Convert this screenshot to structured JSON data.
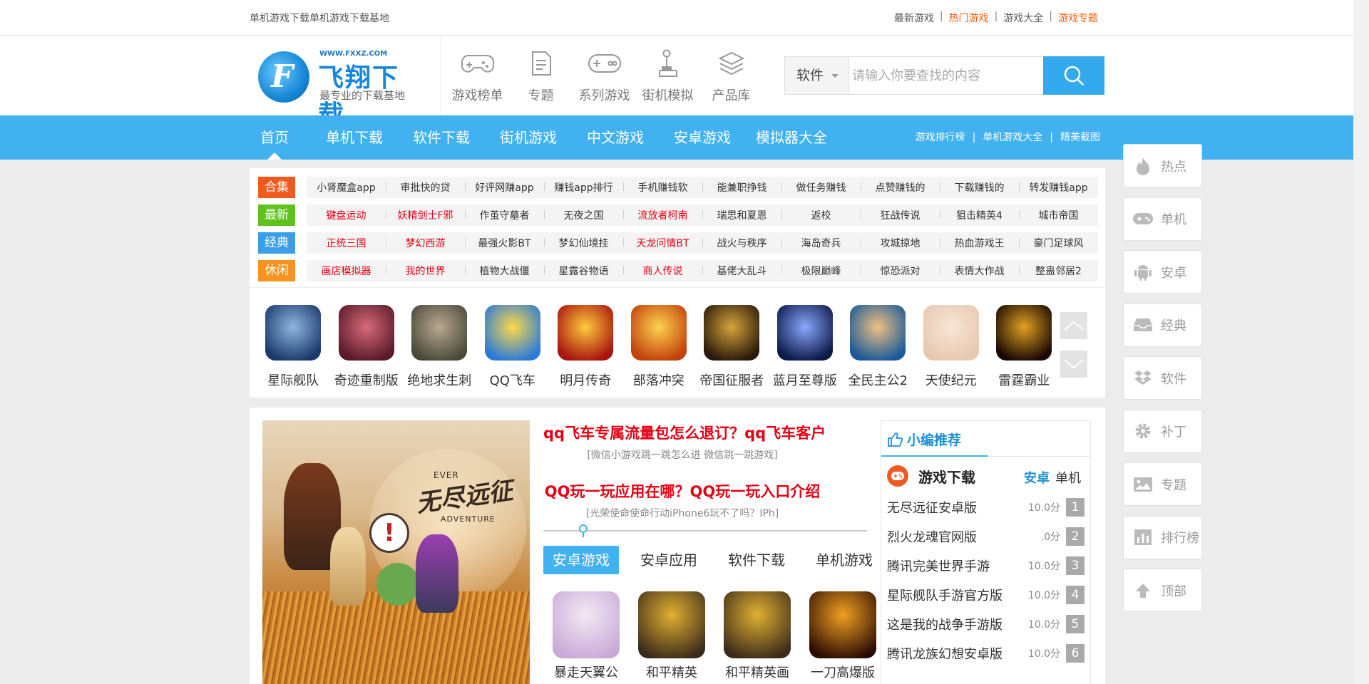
{
  "topbar": {
    "slogan": "单机游戏下载单机游戏下载基地",
    "links": [
      {
        "label": "最新游戏",
        "hot": false
      },
      {
        "label": "热门游戏",
        "hot": true
      },
      {
        "label": "游戏大全",
        "hot": false
      },
      {
        "label": "游戏专题",
        "hot": true
      }
    ]
  },
  "logo": {
    "url": "WWW.FXXZ.COM",
    "name": "飞翔下载",
    "tagline": "最专业的下载基地"
  },
  "header_nav": [
    {
      "label": "游戏榜单",
      "icon": "gamepad-icon"
    },
    {
      "label": "专题",
      "icon": "document-icon"
    },
    {
      "label": "系列游戏",
      "icon": "controller-icon"
    },
    {
      "label": "街机模拟",
      "icon": "joystick-icon"
    },
    {
      "label": "产品库",
      "icon": "layers-icon"
    }
  ],
  "search": {
    "category": "软件",
    "placeholder": "请输入你要查找的内容"
  },
  "main_nav": {
    "links": [
      "首页",
      "单机下载",
      "软件下载",
      "街机游戏",
      "中文游戏",
      "安卓游戏",
      "模拟器大全"
    ],
    "active_index": 0,
    "right_links": [
      "游戏排行榜",
      "单机游戏大全",
      "精美截图"
    ]
  },
  "tag_rows": [
    {
      "badge": "合集",
      "color": "#f05a1e",
      "items": [
        {
          "t": "小肾魔盒app",
          "red": false
        },
        {
          "t": "审批快的贷",
          "red": false
        },
        {
          "t": "好评网赚app",
          "red": false
        },
        {
          "t": "赚钱app排行",
          "red": false
        },
        {
          "t": "手机赚钱软",
          "red": false
        },
        {
          "t": "能兼职挣钱",
          "red": false
        },
        {
          "t": "做任务赚钱",
          "red": false
        },
        {
          "t": "点赞赚钱的",
          "red": false
        },
        {
          "t": "下载赚钱的",
          "red": false
        },
        {
          "t": "转发赚钱app",
          "red": false
        }
      ]
    },
    {
      "badge": "最新",
      "color": "#5ec21b",
      "items": [
        {
          "t": "键盘运动",
          "red": true
        },
        {
          "t": "妖精剑士F邪",
          "red": true
        },
        {
          "t": "作茧守墓者",
          "red": false
        },
        {
          "t": "无夜之国",
          "red": false
        },
        {
          "t": "流放者柯南",
          "red": true
        },
        {
          "t": "瑞思和夏恩",
          "red": false
        },
        {
          "t": "返校",
          "red": false
        },
        {
          "t": "狂战传说",
          "red": false
        },
        {
          "t": "狙击精英4",
          "red": false
        },
        {
          "t": "城市帝国",
          "red": false
        }
      ]
    },
    {
      "badge": "经典",
      "color": "#3a9ee8",
      "items": [
        {
          "t": "正统三国",
          "red": true
        },
        {
          "t": "梦幻西游",
          "red": true
        },
        {
          "t": "最强火影BT",
          "red": false
        },
        {
          "t": "梦幻仙境挂",
          "red": false
        },
        {
          "t": "天龙问情BT",
          "red": true
        },
        {
          "t": "战火与秩序",
          "red": false
        },
        {
          "t": "海岛奇兵",
          "red": false
        },
        {
          "t": "攻城掠地",
          "red": false
        },
        {
          "t": "热血游戏王",
          "red": false
        },
        {
          "t": "豪门足球风",
          "red": false
        }
      ]
    },
    {
      "badge": "休闲",
      "color": "#f7931e",
      "items": [
        {
          "t": "画店模拟器",
          "red": true
        },
        {
          "t": "我的世界",
          "red": true
        },
        {
          "t": "植物大战僵",
          "red": false
        },
        {
          "t": "星露谷物语",
          "red": false
        },
        {
          "t": "商人传说",
          "red": true
        },
        {
          "t": "基佬大乱斗",
          "red": false
        },
        {
          "t": "极限巅峰",
          "red": false
        },
        {
          "t": "惊恐派对",
          "red": false
        },
        {
          "t": "表情大作战",
          "red": false
        },
        {
          "t": "整蛊邻居2",
          "red": false
        }
      ]
    }
  ],
  "game_icons": [
    {
      "name": "星际舰队",
      "c1": "#1b3a6b",
      "c2": "#8fb6e0"
    },
    {
      "name": "奇迹重制版",
      "c1": "#5a1a2a",
      "c2": "#d86a7a"
    },
    {
      "name": "绝地求生刺",
      "c1": "#4a4a3a",
      "c2": "#b8a890"
    },
    {
      "name": "QQ飞车",
      "c1": "#2a7ad8",
      "c2": "#ffd84a"
    },
    {
      "name": "明月传奇",
      "c1": "#a8140e",
      "c2": "#ffcb3a"
    },
    {
      "name": "部落冲突",
      "c1": "#c2410c",
      "c2": "#fcd34d"
    },
    {
      "name": "帝国征服者",
      "c1": "#2a1a0a",
      "c2": "#d6a43a"
    },
    {
      "name": "蓝月至尊版",
      "c1": "#0d1a4a",
      "c2": "#8aa8ff"
    },
    {
      "name": "全民主公2",
      "c1": "#1a5a9a",
      "c2": "#f0c080"
    },
    {
      "name": "天使纪元",
      "c1": "#e8c8b0",
      "c2": "#f6e6d6"
    },
    {
      "name": "雷霆霸业",
      "c1": "#1a0a04",
      "c2": "#e0a020"
    }
  ],
  "headlines": [
    {
      "title": "qq飞车专属流量包怎么退订？qq飞车客户",
      "sub": "[微信小游戏跳一跳怎么进 微信跳一跳游戏]"
    },
    {
      "title": "QQ玩一玩应用在哪？QQ玩一玩入口介绍",
      "sub": "[光荣使命使命行动iPhone6玩不了吗？IPh]"
    }
  ],
  "banner": {
    "logo_text": "无尽远征",
    "logo_sub": "EVER",
    "logo_sub2": "ADVENTURE",
    "bubble": "!"
  },
  "content_tabs": [
    "安卓游戏",
    "安卓应用",
    "软件下载",
    "单机游戏"
  ],
  "content_active_tab": 0,
  "apps": [
    {
      "name": "暴走天翼公",
      "c1": "#c8a8d8",
      "c2": "#f2e8f2"
    },
    {
      "name": "和平精英",
      "c1": "#3a2a1a",
      "c2": "#e0b030"
    },
    {
      "name": "和平精英画",
      "c1": "#3a2a1a",
      "c2": "#e0b030"
    },
    {
      "name": "一刀高爆版",
      "c1": "#2a0a04",
      "c2": "#f0a020"
    }
  ],
  "recommend": {
    "title": "小编推荐",
    "section": "游戏下载",
    "tab_active": "安卓",
    "tab_other": "单机",
    "list": [
      {
        "name": "无尽远征安卓版",
        "score": "10.0分",
        "rank": "1"
      },
      {
        "name": "烈火龙魂官网版",
        "score": ".0分",
        "rank": "2"
      },
      {
        "name": "腾讯完美世界手游",
        "score": "10.0分",
        "rank": "3"
      },
      {
        "name": "星际舰队手游官方版",
        "score": "10.0分",
        "rank": "4"
      },
      {
        "name": "这是我的战争手游版",
        "score": "10.0分",
        "rank": "5"
      },
      {
        "name": "腾讯龙族幻想安卓版",
        "score": "10.0分",
        "rank": "6"
      }
    ]
  },
  "float_sidebar": [
    {
      "label": "热点",
      "icon": "flame-icon"
    },
    {
      "label": "单机",
      "icon": "gamepad-icon"
    },
    {
      "label": "安卓",
      "icon": "android-icon"
    },
    {
      "label": "经典",
      "icon": "inbox-icon"
    },
    {
      "label": "软件",
      "icon": "dropbox-icon"
    },
    {
      "label": "补丁",
      "icon": "gear-icon"
    },
    {
      "label": "专题",
      "icon": "image-icon"
    },
    {
      "label": "排行榜",
      "icon": "bar-chart-icon"
    },
    {
      "label": "顶部",
      "icon": "arrow-up-icon"
    }
  ]
}
